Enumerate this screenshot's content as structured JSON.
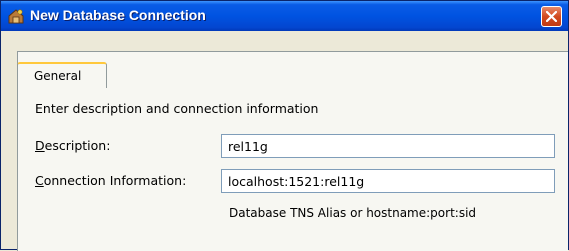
{
  "window": {
    "title": "New Database Connection",
    "icon": "database-icon",
    "close_icon": "close-icon",
    "accent": "#0053e1"
  },
  "tabs": [
    {
      "label": "General",
      "selected": true
    }
  ],
  "form": {
    "intro": "Enter description and connection information",
    "description": {
      "label_mnemonic": "D",
      "label_rest": "escription:",
      "value": "rel11g"
    },
    "connection": {
      "label_mnemonic": "C",
      "label_rest": "onnection Information:",
      "value": "localhost:1521:rel11g"
    },
    "hint": "Database TNS Alias or hostname:port:sid"
  }
}
